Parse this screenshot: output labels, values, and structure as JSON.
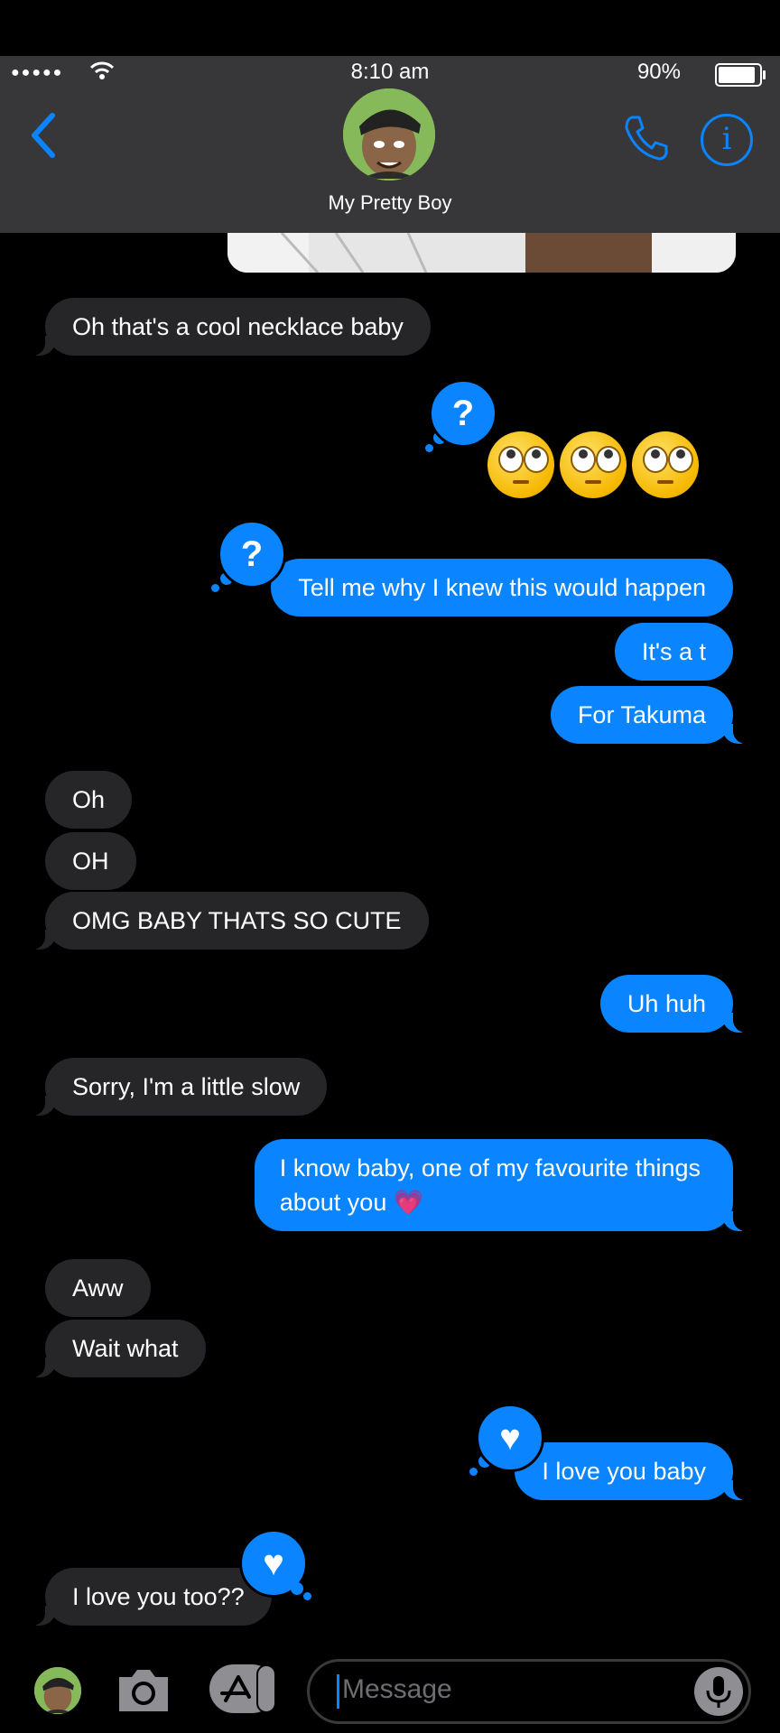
{
  "status": {
    "time": "8:10 am",
    "battery": "90%",
    "battery_level": 0.9
  },
  "header": {
    "contact_name": "My Pretty Boy"
  },
  "messages": [
    {
      "text": "Oh that's a cool necklace baby"
    },
    {
      "text": "Tell me why I knew this would happen"
    },
    {
      "text": "It's a t"
    },
    {
      "text": "For Takuma"
    },
    {
      "text": "Oh"
    },
    {
      "text": "OH"
    },
    {
      "text": "OMG BABY THATS SO CUTE"
    },
    {
      "text": "Uh huh"
    },
    {
      "text": "Sorry, I'm a little slow"
    },
    {
      "text": "I know baby, one of my favourite things",
      "text2": "about you 💗"
    },
    {
      "text": "Aww"
    },
    {
      "text": "Wait what"
    },
    {
      "text": "I love you baby"
    },
    {
      "text": "I love you too??"
    }
  ],
  "tapbacks": {
    "question": "?",
    "heart": "♥"
  },
  "composer": {
    "placeholder": "Message"
  }
}
